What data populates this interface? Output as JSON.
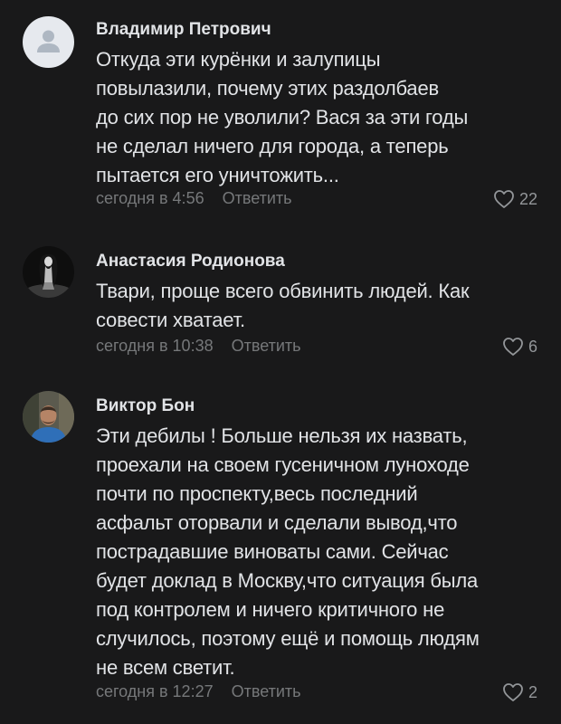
{
  "comments": [
    {
      "author": "Владимир Петрович",
      "lines": [
        "Откуда эти курёнки и залупицы",
        "повылазили, почему этих раздолбаев",
        "до сих пор не уволили? Вася за эти годы",
        "не сделал ничего для города, а теперь",
        "пытается его уничтожить..."
      ],
      "time": "сегодня в 4:56",
      "reply_label": "Ответить",
      "likes": "22",
      "avatar": "default-user-icon"
    },
    {
      "author": "Анастасия Родионова",
      "lines": [
        "Твари, проще всего обвинить людей. Как",
        "совести хватает."
      ],
      "time": "сегодня в 10:38",
      "reply_label": "Ответить",
      "likes": "6",
      "avatar": "photo"
    },
    {
      "author": "Виктор Бон",
      "lines": [
        "Эти дебилы ! Больше нельзя их назвать,",
        "проехали на своем гусеничном луноходе",
        "почти по проспекту,весь последний",
        "асфальт оторвали и сделали вывод,что",
        "пострадавшие виноваты сами. Сейчас",
        "будет доклад в Москву,что ситуация была",
        "под контролем и ничего критичного не",
        "случилось, поэтому ещё и помощь людям",
        "не всем светит."
      ],
      "time": "сегодня в 12:27",
      "reply_label": "Ответить",
      "likes": "2",
      "avatar": "photo"
    }
  ],
  "colors": {
    "background": "#19191a",
    "text": "#e1e3e6",
    "secondary": "#76787a"
  }
}
